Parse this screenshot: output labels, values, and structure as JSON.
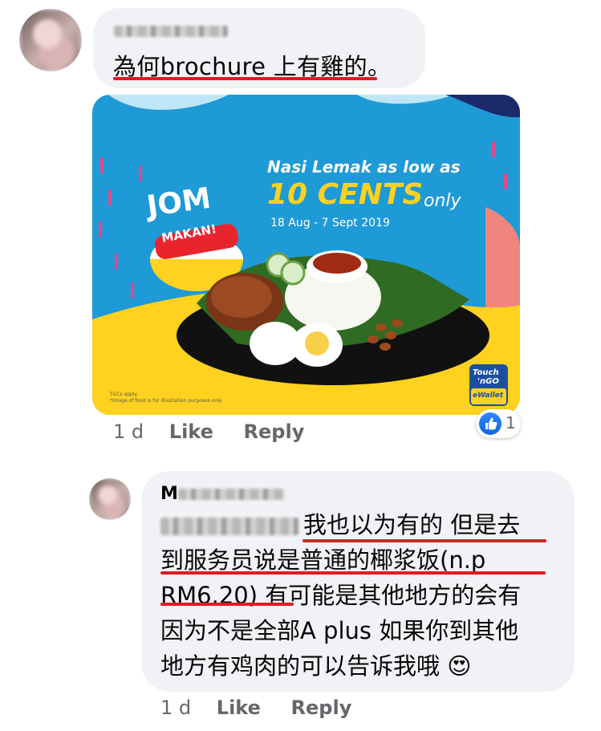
{
  "comment1": {
    "text": "為何brochure 上有雞的。",
    "time": "1 d",
    "like_label": "Like",
    "reply_label": "Reply",
    "reaction_count": "1"
  },
  "promo": {
    "jom": "JOM",
    "makan": "MAKAN!",
    "headline": "Nasi Lemak as low as",
    "price": "10 CENTS",
    "only": "only",
    "dates": "18 Aug - 7 Sept 2019",
    "tnc": "T&Cs apply.",
    "disclaimer": "*Image of food is for illustration purposes only.",
    "logo_line1": "Touch",
    "logo_line2": "'nGO",
    "logo_line3": "eWallet"
  },
  "comment2": {
    "author_initial": "M",
    "lines": [
      "我也以为有的 但是去",
      "到服务员说是普通的椰浆饭(n.p",
      "RM6.20) 有可能是其他地方的会有",
      "因为不是全部A plus 如果你到其他",
      "地方有鸡肉的可以告诉我哦 😍"
    ],
    "time": "1 d",
    "like_label": "Like",
    "reply_label": "Reply"
  },
  "colors": {
    "underline": "#e01b24",
    "bubble": "#f0f2f5",
    "meta_text": "#65676b",
    "promo_blue": "#1e9ad6",
    "promo_yellow": "#ffd21f",
    "promo_red": "#e9242d"
  }
}
